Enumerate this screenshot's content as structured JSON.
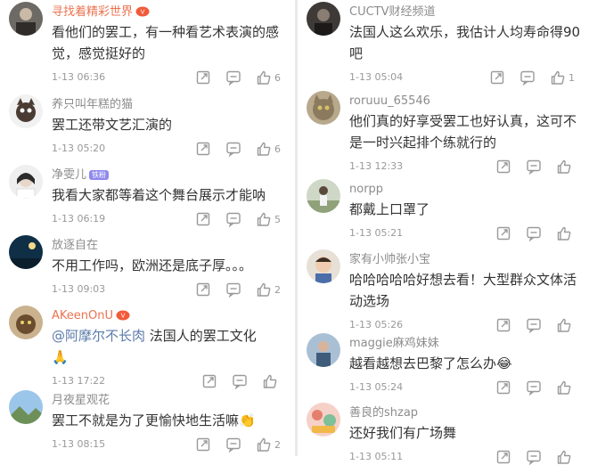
{
  "left": [
    {
      "user": "寻找着精彩世界",
      "user_color": "#eb7350",
      "badge": "",
      "vip": true,
      "text_lines": [
        "看他们的罢工，有一种看艺术表演的感",
        "觉，感觉挺好的"
      ],
      "time": "1-13 06:36",
      "likes": "6",
      "avatar": "portrait-dark"
    },
    {
      "user": "养只叫年糕的猫",
      "user_color": "#8c8c8c",
      "badge": "",
      "vip": false,
      "text_lines": [
        "罢工还带文艺汇演的"
      ],
      "time": "1-13 05:20",
      "likes": "6",
      "avatar": "cartoon-cat"
    },
    {
      "user": "净雯儿",
      "user_color": "#8c8c8c",
      "badge": "铁粉",
      "vip": false,
      "text_lines": [
        "我看大家都等着这个舞台展示才能呐"
      ],
      "time": "1-13 06:19",
      "likes": "5",
      "avatar": "girl-white"
    },
    {
      "user": "放逐自在",
      "user_color": "#8c8c8c",
      "badge": "",
      "vip": false,
      "text_lines": [
        "不用工作吗，欧洲还是底子厚。。。"
      ],
      "time": "1-13 09:03",
      "likes": "2",
      "avatar": "night-sky"
    },
    {
      "user": "AKeenOnU",
      "user_color": "#eb7350",
      "badge": "",
      "vip": true,
      "text_lines": [
        "@阿摩尔不长肉 法国人的罢工文化",
        "🙏"
      ],
      "time": "1-13 17:22",
      "likes": "",
      "avatar": "cat-brown"
    },
    {
      "user": "月夜星观花",
      "user_color": "#8c8c8c",
      "badge": "",
      "vip": false,
      "text_lines": [
        "罢工不就是为了更愉快地生活嘛👏"
      ],
      "time": "1-13 08:15",
      "likes": "2",
      "avatar": "landscape"
    }
  ],
  "right": [
    {
      "user": "CUCTV财经频道",
      "user_color": "#8c8c8c",
      "badge": "",
      "vip": false,
      "text_lines": [
        "法国人这么欢乐，我估计人均寿命得90",
        "吧"
      ],
      "time": "1-13 05:04",
      "likes": "1",
      "avatar": "photo-dark"
    },
    {
      "user": "roruuu_65546",
      "user_color": "#8c8c8c",
      "badge": "",
      "vip": false,
      "text_lines": [
        "他们真的好享受罢工也好认真，这可不",
        "是一时兴起排个练就行的"
      ],
      "time": "1-13 12:33",
      "likes": "",
      "avatar": "tabby-cat"
    },
    {
      "user": "norpp",
      "user_color": "#8c8c8c",
      "badge": "",
      "vip": false,
      "text_lines": [
        "都戴上口罩了"
      ],
      "time": "1-13 05:21",
      "likes": "",
      "avatar": "person-field"
    },
    {
      "user": "家有小帅张小宝",
      "user_color": "#8c8c8c",
      "badge": "",
      "vip": false,
      "text_lines": [
        "哈哈哈哈哈好想去看！大型群众文体活",
        "动选场"
      ],
      "time": "1-13 05:26",
      "likes": "",
      "avatar": "child"
    },
    {
      "user": "maggie麻鸡妹妹",
      "user_color": "#8c8c8c",
      "badge": "",
      "vip": false,
      "text_lines": [
        "越看越想去巴黎了怎么办😂"
      ],
      "time": "1-13 05:24",
      "likes": "",
      "avatar": "person-outdoor"
    },
    {
      "user": "善良的shzap",
      "user_color": "#8c8c8c",
      "badge": "",
      "vip": false,
      "text_lines": [
        "还好我们有广场舞"
      ],
      "time": "1-13 05:11",
      "likes": "",
      "avatar": "colorful"
    }
  ],
  "colors": {
    "username_highlight": "#eb7350",
    "username_normal": "#8c8c8c",
    "text": "#333333",
    "meta": "#999999",
    "mention": "#5b7ba8",
    "badge": "#8f88ee",
    "divider": "#e9e9e9"
  },
  "icons": [
    "share-icon",
    "comment-icon",
    "like-icon"
  ]
}
